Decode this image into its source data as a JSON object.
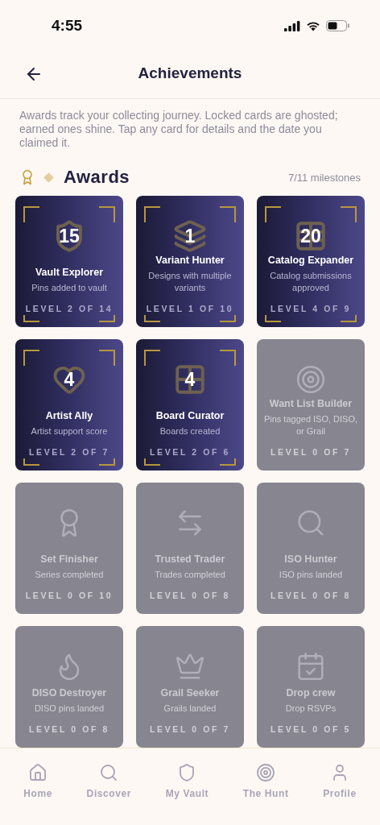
{
  "status_bar": {
    "time": "4:55"
  },
  "header": {
    "title": "Achievements"
  },
  "intro": "Awards track your collecting journey. Locked cards are ghosted; earned ones shine. Tap any card for details and the date you claimed it.",
  "section": {
    "title": "Awards",
    "count": "7/11 milestones"
  },
  "cards": [
    {
      "title": "Vault Explorer",
      "subtitle": "Pins added to vault",
      "level_text": "LEVEL 2 OF 14",
      "earned": true,
      "value": "15"
    },
    {
      "title": "Variant Hunter",
      "subtitle": "Designs with multiple variants",
      "level_text": "LEVEL 1 OF 10",
      "earned": true,
      "value": "1"
    },
    {
      "title": "Catalog Expander",
      "subtitle": "Catalog submissions approved",
      "level_text": "LEVEL 4 OF 9",
      "earned": true,
      "value": "20"
    },
    {
      "title": "Artist Ally",
      "subtitle": "Artist support score",
      "level_text": "LEVEL 2 OF 7",
      "earned": true,
      "value": "4"
    },
    {
      "title": "Board Curator",
      "subtitle": "Boards created",
      "level_text": "LEVEL 2 OF 6",
      "earned": true,
      "value": "4"
    },
    {
      "title": "Want List Builder",
      "subtitle": "Pins tagged ISO, DISO, or Grail",
      "level_text": "LEVEL 0 OF 7",
      "earned": false
    },
    {
      "title": "Set Finisher",
      "subtitle": "Series completed",
      "level_text": "LEVEL 0 OF 10",
      "earned": false
    },
    {
      "title": "Trusted Trader",
      "subtitle": "Trades completed",
      "level_text": "LEVEL 0 OF 8",
      "earned": false
    },
    {
      "title": "ISO Hunter",
      "subtitle": "ISO pins landed",
      "level_text": "LEVEL 0 OF 8",
      "earned": false
    },
    {
      "title": "DISO Destroyer",
      "subtitle": "DISO pins landed",
      "level_text": "LEVEL 0 OF 8",
      "earned": false
    },
    {
      "title": "Grail Seeker",
      "subtitle": "Grails landed",
      "level_text": "LEVEL 0 OF 7",
      "earned": false
    },
    {
      "title": "Drop crew",
      "subtitle": "Drop RSVPs",
      "level_text": "LEVEL 0 OF 5",
      "earned": false
    }
  ],
  "tab_bar": [
    {
      "label": "Home"
    },
    {
      "label": "Discover"
    },
    {
      "label": "My Vault"
    },
    {
      "label": "The Hunt"
    },
    {
      "label": "Profile"
    }
  ]
}
